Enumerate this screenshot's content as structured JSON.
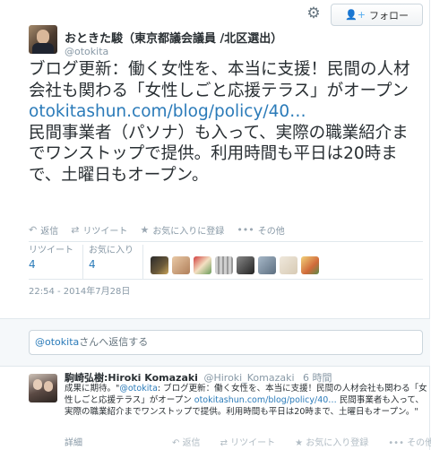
{
  "header": {
    "follow_label": "フォロー"
  },
  "author": {
    "name": "おときた駿（東京都議会議員 /北区選出）",
    "handle": "@otokita"
  },
  "tweet": {
    "line1": "ブログ更新：働く女性を、本当に支援！民間の人材会社も関わる「女性しごと応援テラス」がオープン",
    "link": "otokitashun.com/blog/policy/40…",
    "line2": "民間事業者（パソナ）も入って、実際の職業紹介までワンストップで提供。利用時間も平日は20時まで、土曜日もオープン。"
  },
  "actions": {
    "reply": "返信",
    "retweet": "リツイート",
    "favorite": "お気に入りに登録",
    "more": "その他"
  },
  "stats": {
    "retweets_label": "リツイート",
    "retweets": "4",
    "favorites_label": "お気に入り",
    "favorites": "4"
  },
  "timestamp": "22:54 - 2014年7月28日",
  "reply_box": {
    "mention": "@otokita",
    "suffix": "さんへ返信する"
  },
  "reply": {
    "name": "駒崎弘樹:Hiroki Komazaki",
    "handle": "@Hiroki_Komazaki",
    "time": "6 時間",
    "text_prefix": "成果に期待。\"",
    "mention": "@otokita",
    "text_body": ": ブログ更新：働く女性を、本当に支援！民間の人材会社も関わる「女性しごと応援テラス」がオープン ",
    "link": "otokitashun.com/blog/policy/40…",
    "text_tail": " 民間事業者も入って、実際の職業紹介までワンストップで提供。利用時間も平日は20時まで、土曜日もオープン。\"",
    "details": "詳細",
    "actions": {
      "reply": "返信",
      "retweet": "リツイート",
      "favorite": "お気に入り登録",
      "more": "その他"
    }
  },
  "colors": {
    "link": "#2b7bb9",
    "muted": "#8899a6",
    "follow_icon": "#55acee"
  }
}
